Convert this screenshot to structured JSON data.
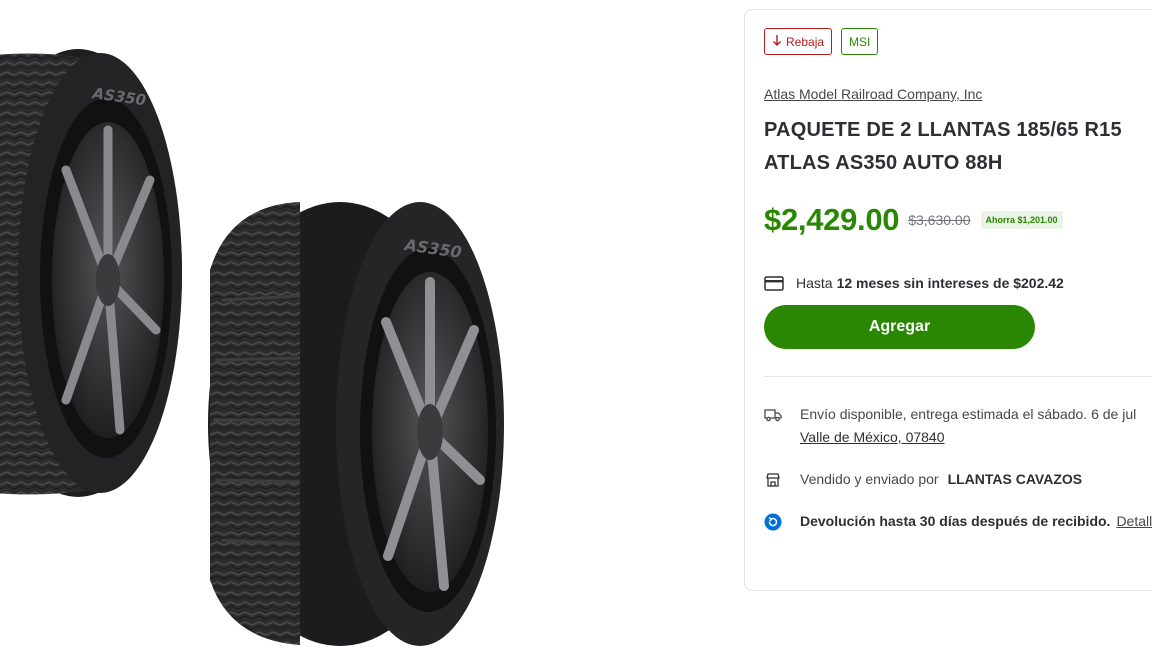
{
  "gallery": {
    "tire_brand_mark": "AS350"
  },
  "badges": {
    "rollback": {
      "label": "Rebaja",
      "icon": "arrow-down-icon"
    },
    "msi": {
      "label": "MSI"
    }
  },
  "product": {
    "brand": "Atlas Model Railroad Company, Inc",
    "title": "PAQUETE DE 2 LLANTAS 185/65 R15 ATLAS AS350 AUTO 88H"
  },
  "pricing": {
    "current": "$2,429.00",
    "was": "$3,630.00",
    "savings": "Ahorra $1,201.00"
  },
  "installments": {
    "prefix": "Hasta",
    "bold": "12 meses sin intereses de $202.42",
    "icon": "credit-card-icon"
  },
  "actions": {
    "add_label": "Agregar"
  },
  "shipping": {
    "text": "Envío disponible, entrega estimada el sábado. 6 de jul",
    "location": "Valle de México, 07840",
    "icon": "truck-icon"
  },
  "seller": {
    "prefix": "Vendido y enviado por",
    "name": "LLANTAS CAVAZOS",
    "icon": "store-icon"
  },
  "returns": {
    "text": "Devolución hasta 30 días después de recibido.",
    "details": "Detalles",
    "icon": "return-icon"
  },
  "colors": {
    "accent_green": "#2a8703",
    "rollback_red": "#b51c1c",
    "text_dark": "#2e2f32",
    "return_blue": "#0071dc"
  }
}
